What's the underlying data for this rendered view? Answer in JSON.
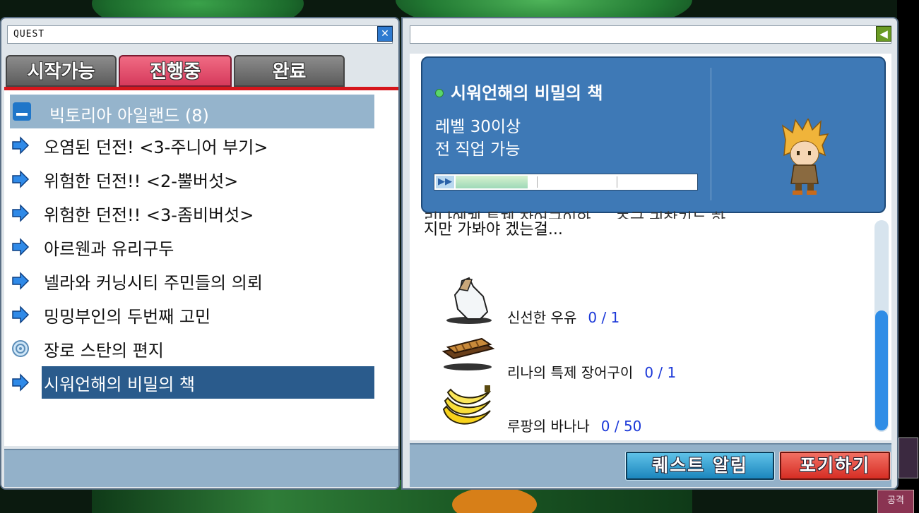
{
  "left_window": {
    "title": "QUEST",
    "tabs": [
      {
        "label": "시작가능",
        "active": false
      },
      {
        "label": "진행중",
        "active": true
      },
      {
        "label": "완료",
        "active": false
      }
    ],
    "region": "빅토리아 아일랜드 (8)",
    "quests": [
      {
        "label": "오염된 던전! <3-주니어 부기>",
        "icon": "arrow-icon",
        "selected": false
      },
      {
        "label": "위험한 던전!! <2-뿔버섯>",
        "icon": "arrow-icon",
        "selected": false
      },
      {
        "label": "위험한 던전!! <3-좀비버섯>",
        "icon": "arrow-icon",
        "selected": false
      },
      {
        "label": "아르웬과 유리구두",
        "icon": "arrow-icon",
        "selected": false
      },
      {
        "label": "넬라와 커닝시티 주민들의 의뢰",
        "icon": "arrow-icon",
        "selected": false
      },
      {
        "label": "밍밍부인의 두번째 고민",
        "icon": "arrow-icon",
        "selected": false
      },
      {
        "label": "장로 스탄의 편지",
        "icon": "target-icon",
        "selected": false
      },
      {
        "label": "시워언해의 비밀의 책",
        "icon": "arrow-icon",
        "selected": true
      }
    ]
  },
  "detail": {
    "quest_name": "시워언해의 비밀의 책",
    "requirement_level": "레벨 30이상",
    "requirement_job": "전 직업 가능",
    "progress": 0.3,
    "description_cut": "리나에게 특제 장어구이와 ... 조금 귀찮기는 하",
    "description": "지만 가봐야 겠는걸...",
    "items": [
      {
        "name": "신선한 우유",
        "count": "0 / 1",
        "icon": "milk-bottle-icon"
      },
      {
        "name": "리나의 특제 장어구이",
        "count": "0 / 1",
        "icon": "grilled-eel-icon"
      },
      {
        "name": "루팡의 바나나",
        "count": "0 / 50",
        "icon": "banana-icon"
      }
    ],
    "buttons": {
      "notify": "퀘스트 알림",
      "give_up": "포기하기"
    }
  },
  "hud": {
    "attack_label": "공격"
  },
  "colors": {
    "tab_active": "#d63a5c",
    "selected_row": "#2a5b8c",
    "info_card": "#3e79b6",
    "count_text": "#1b38d8",
    "give_up": "#d62d24",
    "notify": "#1c86bd"
  }
}
